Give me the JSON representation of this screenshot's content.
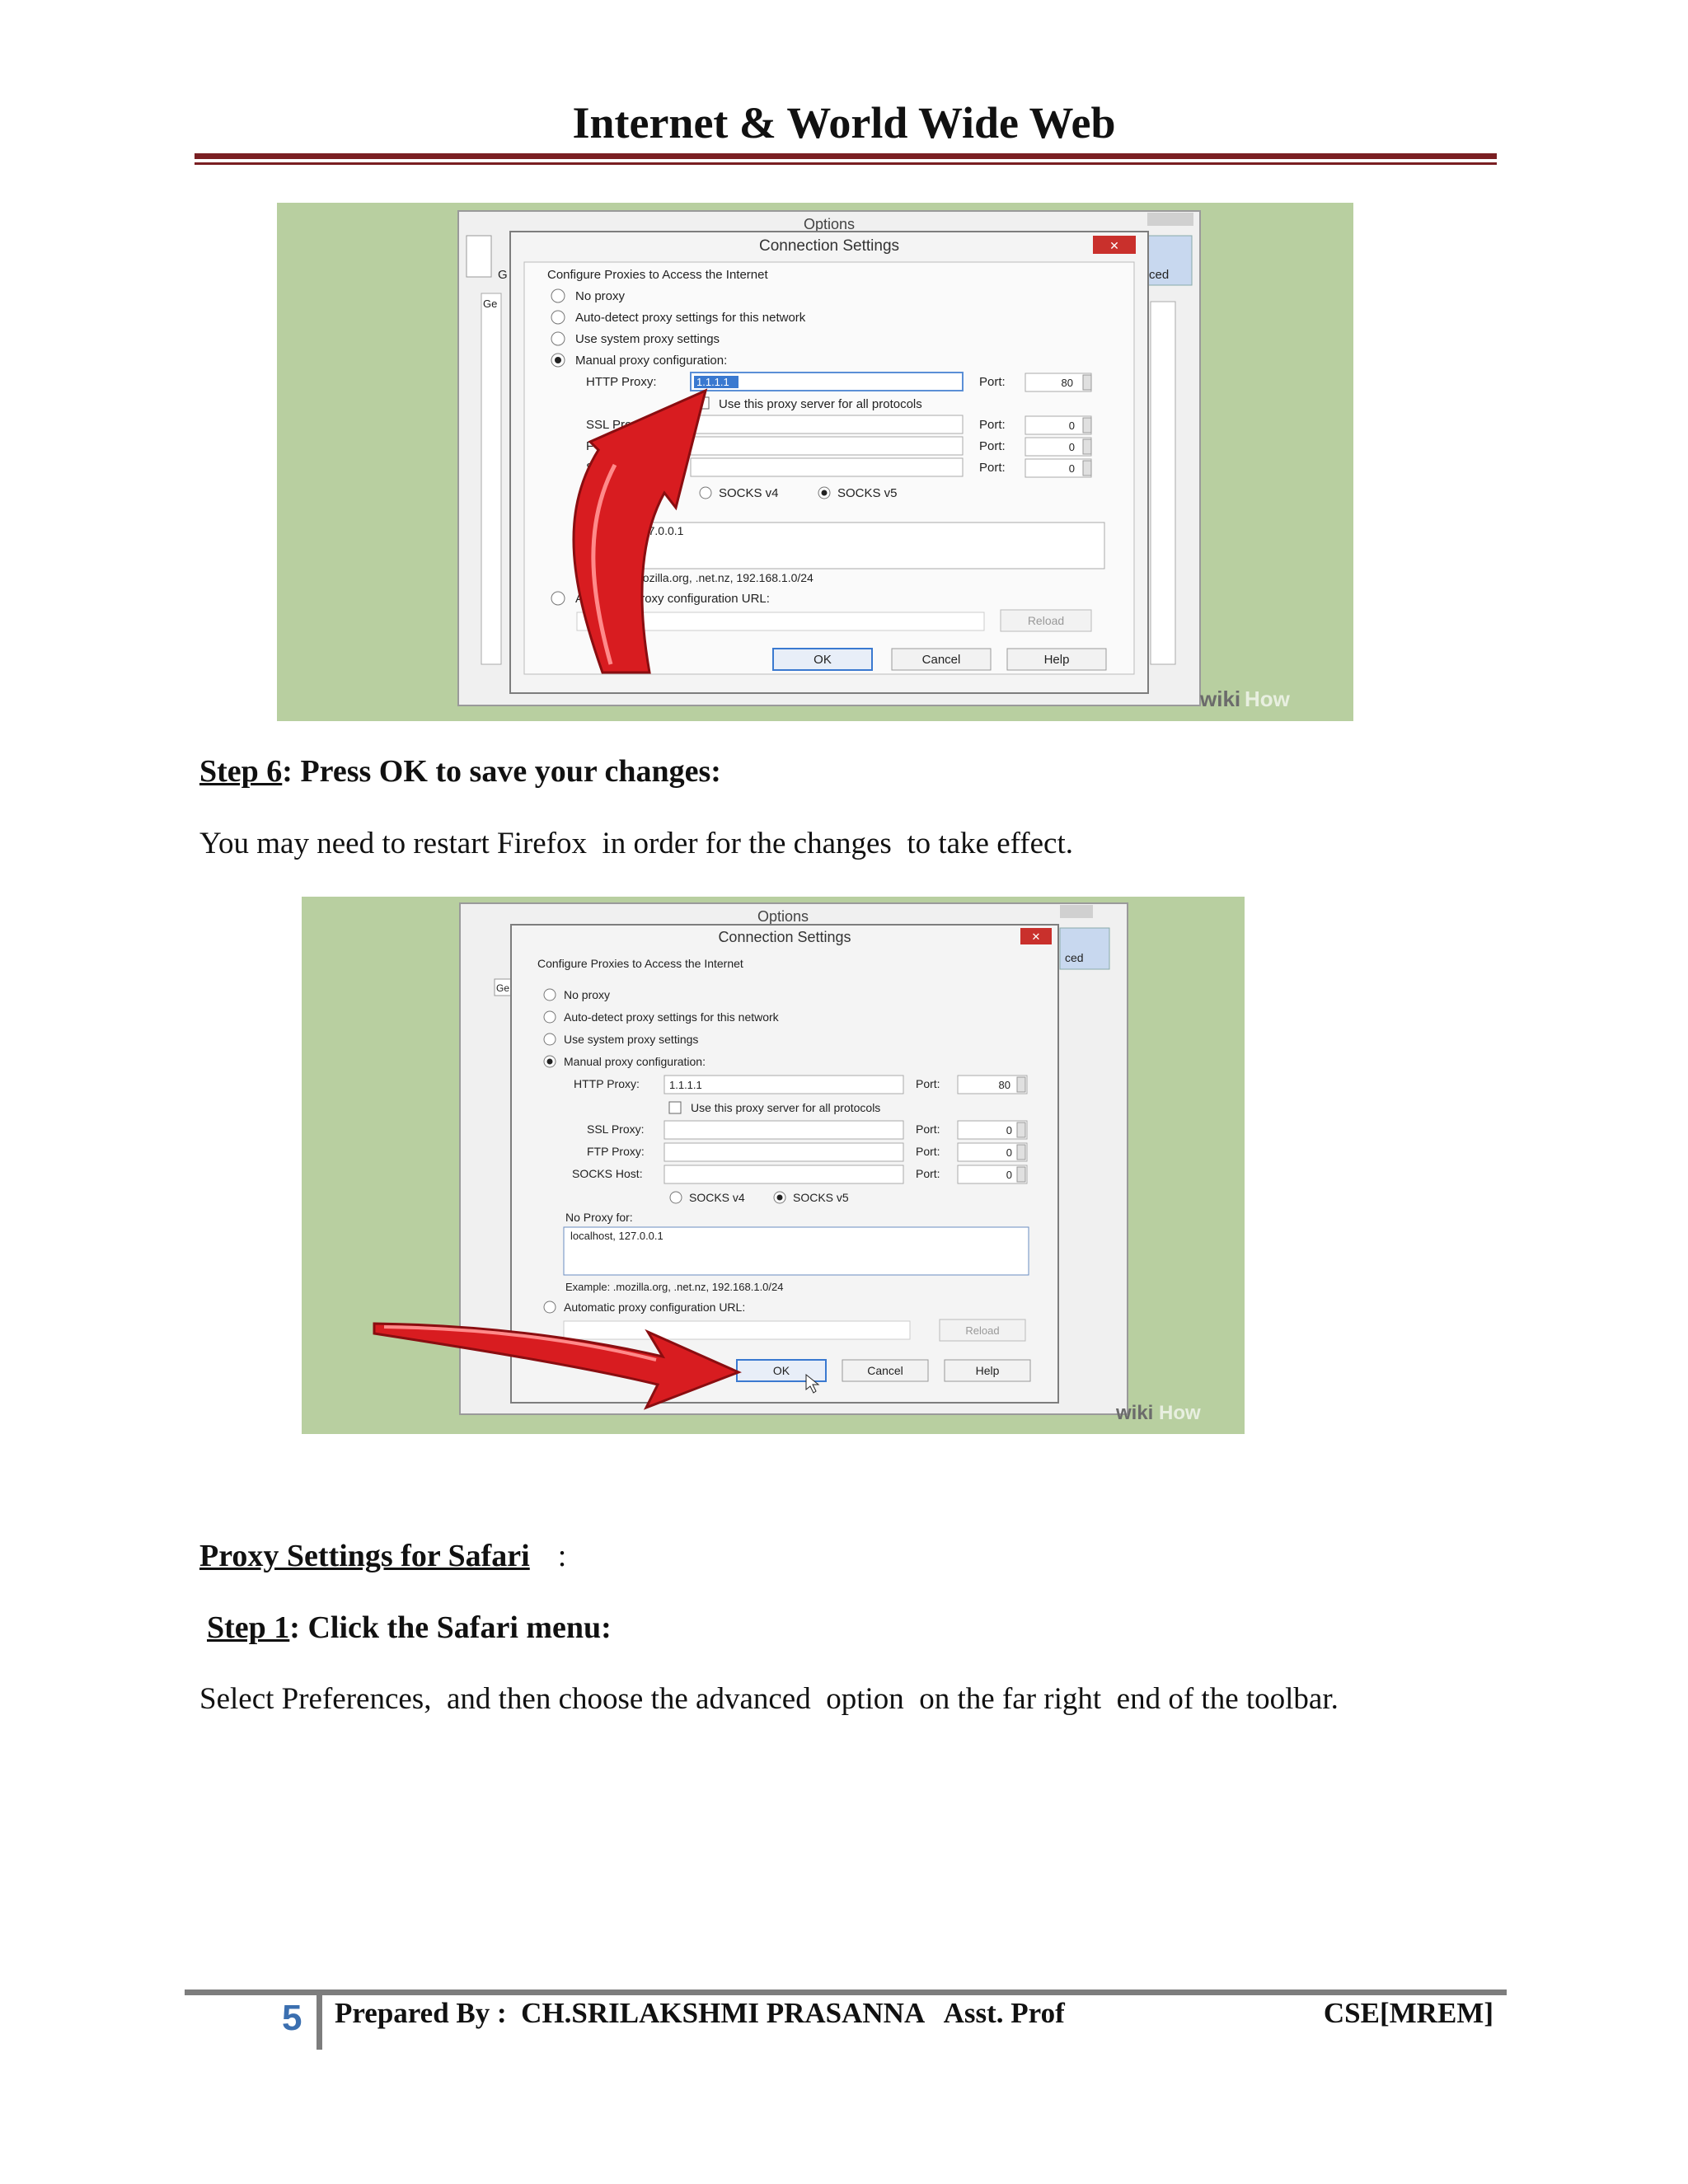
{
  "header": {
    "title": "Internet & World Wide Web"
  },
  "dialog": {
    "outer_title": "Options",
    "title": "Connection Settings",
    "close": "✕",
    "group_label": "Configure Proxies to Access the Internet",
    "options": [
      "No proxy",
      "Auto-detect proxy settings for this network",
      "Use system proxy settings",
      "Manual proxy configuration:"
    ],
    "http_proxy_label": "HTTP Proxy:",
    "http_proxy_value": "1.1.1.1",
    "port_label": "Port:",
    "port_value": "80",
    "zero": "0",
    "use_all_label": "Use this proxy server for all protocols",
    "ssl_label": "SSL Proxy:",
    "ftp_label": "FTP Proxy:",
    "socks_label": "SOCKS Host:",
    "socks4": "SOCKS v4",
    "socks5": "SOCKS v5",
    "no_proxy_label": "No Proxy for:",
    "no_proxy_value": "localhost, 127.0.0.1",
    "example": "Example: .mozilla.org, .net.nz, 192.168.1.0/24",
    "auto_url_label": "Automatic proxy configuration URL:",
    "reload": "Reload",
    "ok": "OK",
    "cancel": "Cancel",
    "help": "Help",
    "bg_tab_left": "G",
    "bg_tab_left2": "Ge",
    "bg_tab_right": "ced",
    "watermark_a": "wiki",
    "watermark_b": "How"
  },
  "step6": {
    "label": "Step 6",
    "text": ": Press OK to save your changes:",
    "para": "You may need to restart Firefox  in order for the changes  to take effect."
  },
  "safari": {
    "heading": "Proxy Settings for Safari",
    "colon": ":"
  },
  "step1": {
    "label": "Step 1",
    "text": ": Click the Safari menu:",
    "para": "Select Preferences,  and then choose the advanced  option  on the far right  end of the toolbar."
  },
  "footer": {
    "page_number": "5",
    "prepared": "Prepared By :  CH.SRILAKSHMI PRASANNA   Asst. Prof",
    "dept": "CSE[MREM]"
  }
}
